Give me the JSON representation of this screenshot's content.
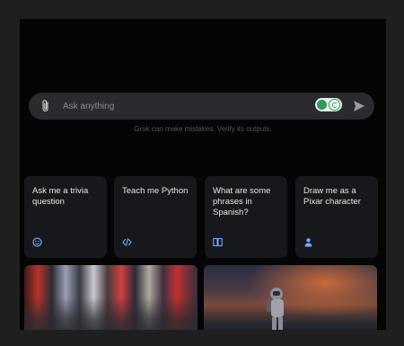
{
  "composer": {
    "placeholder": "Ask anything",
    "disclaimer": "Grok can make mistakes. Verify its outputs."
  },
  "suggestions": [
    {
      "label": "Ask me a trivia question",
      "icon": "smiley-icon"
    },
    {
      "label": "Teach me Python",
      "icon": "code-icon"
    },
    {
      "label": "What are some phrases in Spanish?",
      "icon": "book-icon"
    },
    {
      "label": "Draw me as a Pixar character",
      "icon": "person-icon"
    }
  ],
  "colors": {
    "accent_icon": "#6ea8ff",
    "card_bg": "#17181b",
    "input_bg": "#2a2b2e"
  }
}
